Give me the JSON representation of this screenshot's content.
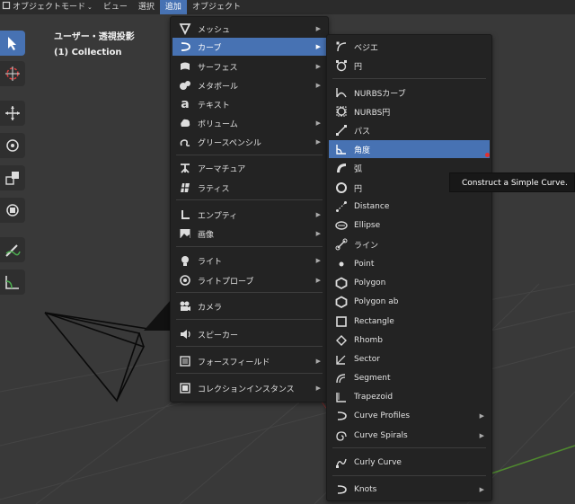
{
  "header": {
    "items": [
      {
        "label": "オブジェクトモード"
      },
      {
        "label": "ビュー"
      },
      {
        "label": "選択"
      },
      {
        "label": "追加"
      },
      {
        "label": "オブジェクト"
      }
    ]
  },
  "viewport": {
    "view_name": "ユーザー・透視投影",
    "collection": "(1) Collection"
  },
  "add_menu": {
    "items": [
      {
        "label": "メッシュ",
        "icon": "mesh-icon"
      },
      {
        "label": "カーブ",
        "icon": "curve-icon"
      },
      {
        "label": "サーフェス",
        "icon": "surface-icon"
      },
      {
        "label": "メタボール",
        "icon": "metaball-icon"
      },
      {
        "label": "テキスト",
        "icon": "text-icon"
      },
      {
        "label": "ボリューム",
        "icon": "volume-icon"
      },
      {
        "label": "グリースペンシル",
        "icon": "grease-pencil-icon"
      },
      {
        "label": "アーマチュア",
        "icon": "armature-icon"
      },
      {
        "label": "ラティス",
        "icon": "lattice-icon"
      },
      {
        "label": "エンプティ",
        "icon": "empty-icon"
      },
      {
        "label": "画像",
        "icon": "image-icon"
      },
      {
        "label": "ライト",
        "icon": "light-icon"
      },
      {
        "label": "ライトプローブ",
        "icon": "light-probe-icon"
      },
      {
        "label": "カメラ",
        "icon": "camera-icon"
      },
      {
        "label": "スピーカー",
        "icon": "speaker-icon"
      },
      {
        "label": "フォースフィールド",
        "icon": "force-field-icon"
      },
      {
        "label": "コレクションインスタンス",
        "icon": "collection-icon"
      }
    ]
  },
  "curve_menu": {
    "items": [
      {
        "label": "ベジエ",
        "icon": "bezier-icon"
      },
      {
        "label": "円",
        "icon": "circle-curve-icon"
      },
      {
        "label": "NURBSカーブ",
        "icon": "nurbs-curve-icon"
      },
      {
        "label": "NURBS円",
        "icon": "nurbs-circle-icon"
      },
      {
        "label": "パス",
        "icon": "path-icon"
      },
      {
        "label": "角度",
        "icon": "angle-icon"
      },
      {
        "label": "弧",
        "icon": "arc-icon"
      },
      {
        "label": "円",
        "icon": "circle-icon"
      },
      {
        "label": "Distance",
        "icon": "distance-icon"
      },
      {
        "label": "Ellipse",
        "icon": "ellipse-icon"
      },
      {
        "label": "ライン",
        "icon": "line-icon"
      },
      {
        "label": "Point",
        "icon": "point-icon"
      },
      {
        "label": "Polygon",
        "icon": "polygon-icon"
      },
      {
        "label": "Polygon ab",
        "icon": "polygon-ab-icon"
      },
      {
        "label": "Rectangle",
        "icon": "rectangle-icon"
      },
      {
        "label": "Rhomb",
        "icon": "rhomb-icon"
      },
      {
        "label": "Sector",
        "icon": "sector-icon"
      },
      {
        "label": "Segment",
        "icon": "segment-icon"
      },
      {
        "label": "Trapezoid",
        "icon": "trapezoid-icon"
      },
      {
        "label": "Curve Profiles",
        "icon": "curve-profiles-icon"
      },
      {
        "label": "Curve Spirals",
        "icon": "curve-spirals-icon"
      },
      {
        "label": "Curly Curve",
        "icon": "curly-curve-icon"
      },
      {
        "label": "Knots",
        "icon": "knots-icon"
      }
    ]
  },
  "tooltip": {
    "text": "Construct a Simple Curve."
  },
  "colors": {
    "accent": "#4772b3",
    "menu_bg": "#232323",
    "viewport_bg": "#393939"
  }
}
